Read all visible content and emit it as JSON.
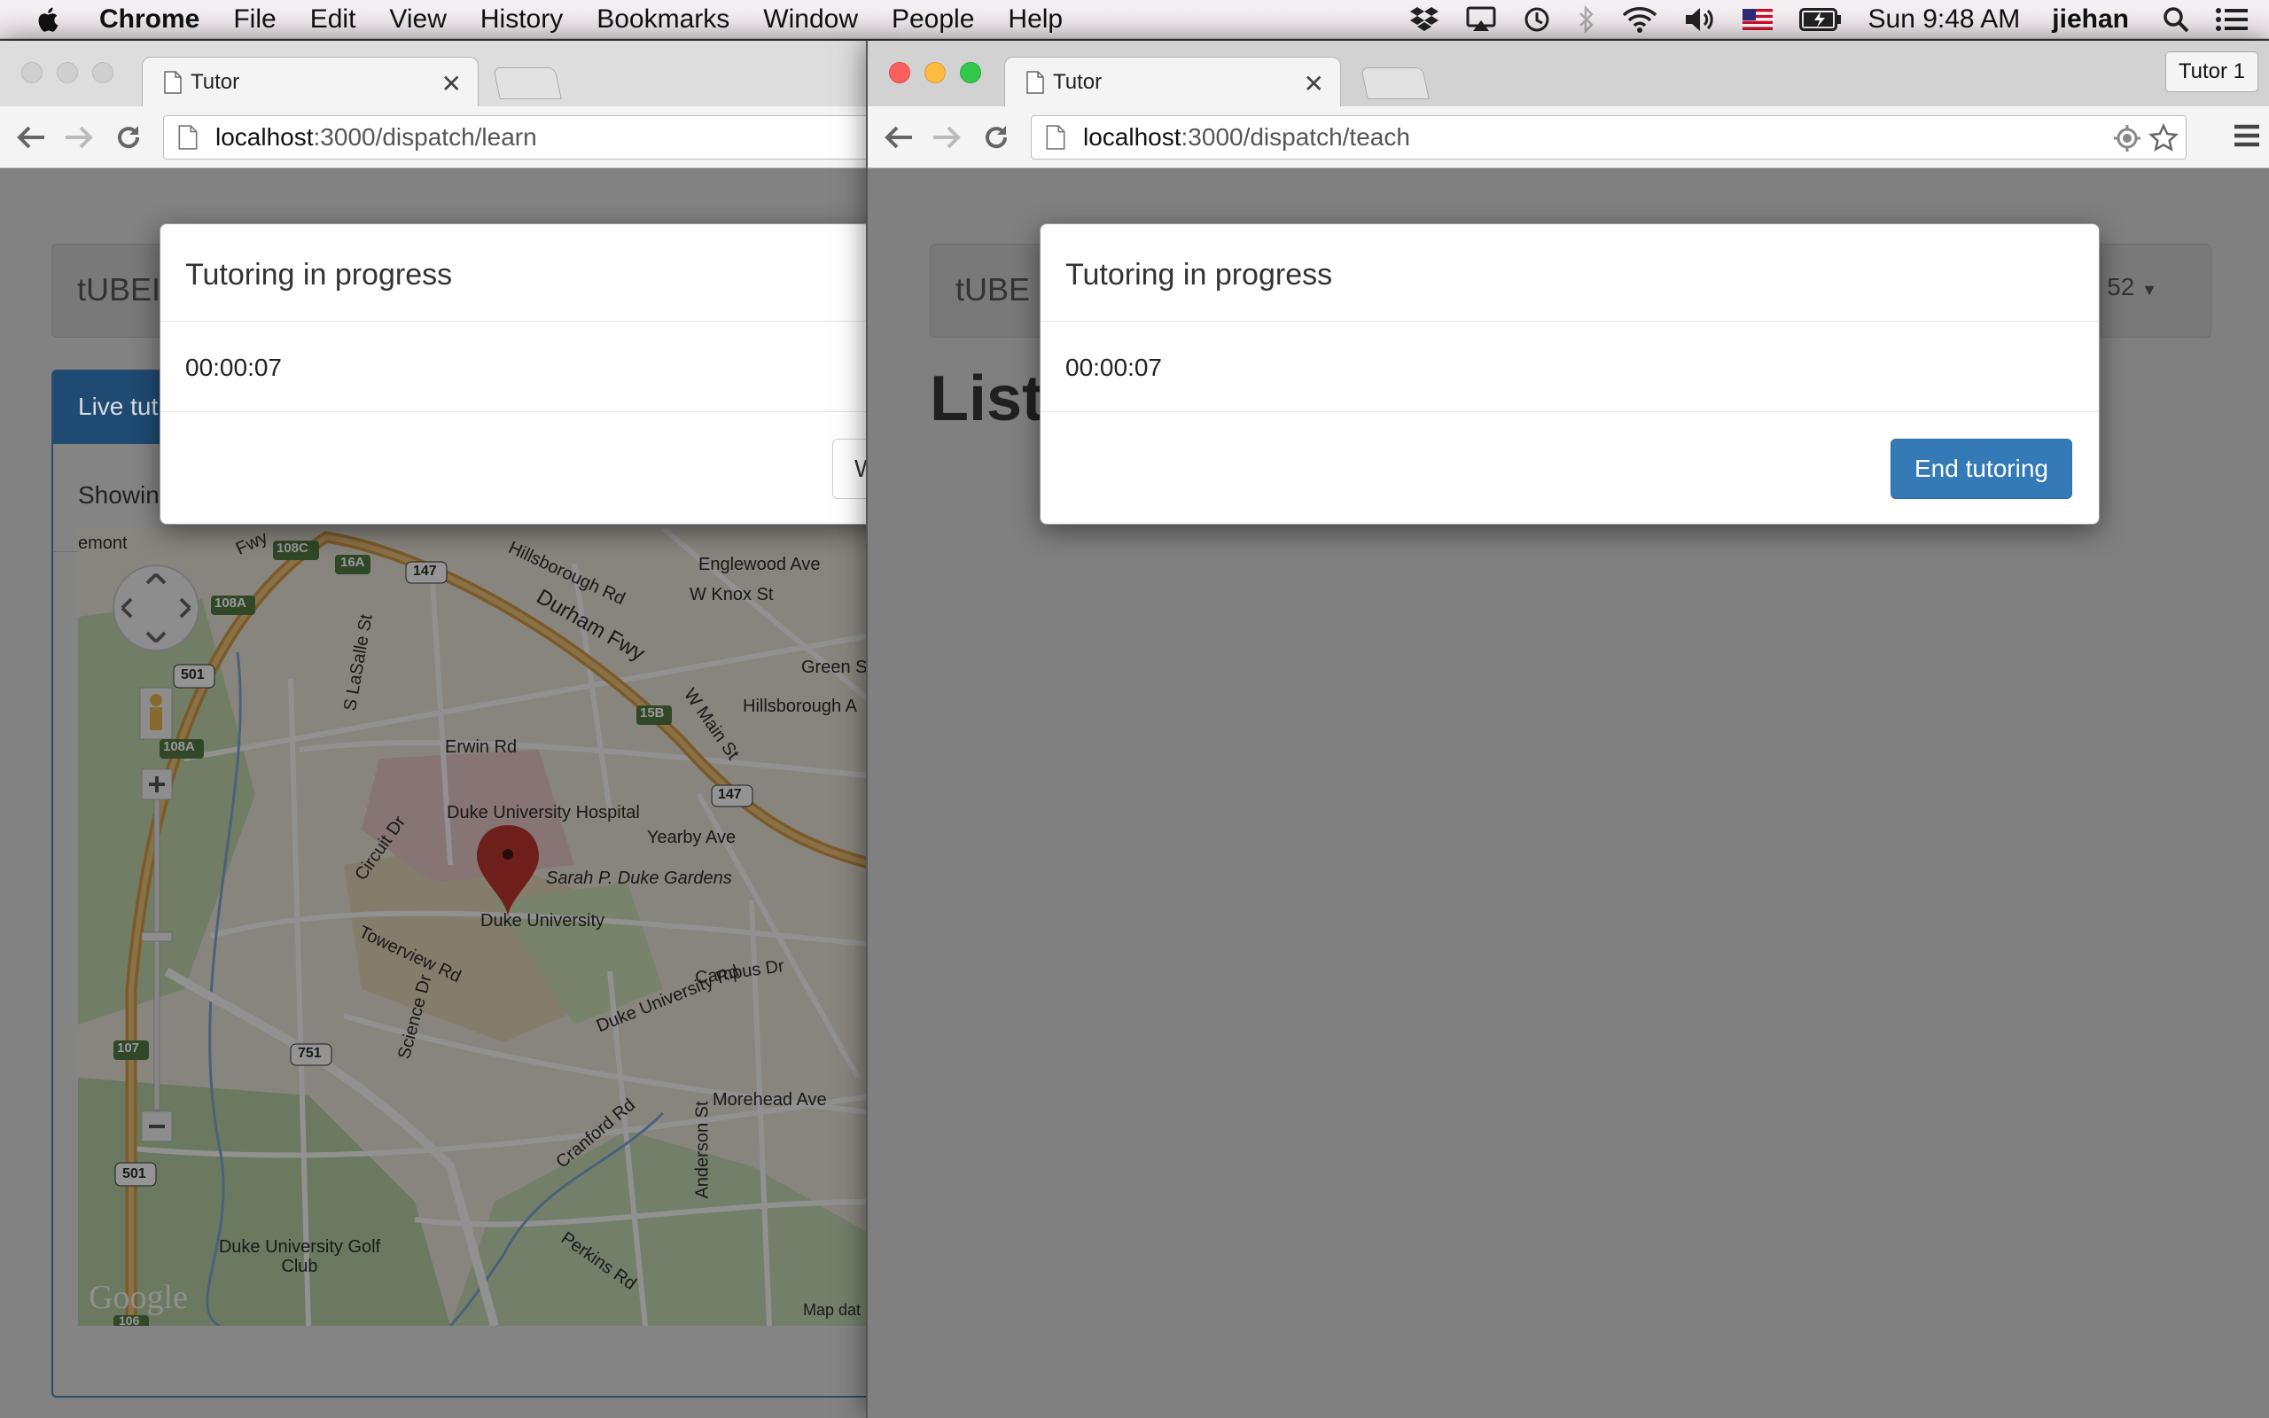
{
  "menubar": {
    "app_name": "Chrome",
    "items": [
      "File",
      "Edit",
      "View",
      "History",
      "Bookmarks",
      "Window",
      "People",
      "Help"
    ],
    "clock": "Sun 9:48 AM",
    "user": "jiehan",
    "status_icons": [
      "dropbox-icon",
      "airplay-icon",
      "time-machine-icon",
      "bluetooth-icon",
      "wifi-icon",
      "volume-icon",
      "us-flag-icon",
      "battery-icon",
      "spotlight-icon",
      "notification-center-icon"
    ]
  },
  "left_window": {
    "tab_title": "Tutor",
    "url_host": "localhost",
    "url_path": ":3000/dispatch/learn",
    "brand": "tUBEI",
    "panel_title": "Live tut",
    "panel_subtitle": "Showin",
    "modal": {
      "title": "Tutoring in progress",
      "timer": "00:00:07",
      "button_label": "W"
    },
    "map": {
      "labels": {
        "hospital": "Duke University Hospital",
        "gardens": "Sarah P. Duke Gardens",
        "university": "Duke University",
        "golf": "Duke University Golf Club",
        "durham_fwy": "Durham Fwy",
        "erwin": "Erwin Rd",
        "hillsborough": "Hillsborough Rd",
        "englewood": "Englewood Ave",
        "knox": "W Knox St",
        "green": "Green St",
        "hillsborough2": "Hillsborough A",
        "wmain": "W Main St",
        "yearby": "Yearby Ave",
        "circuit": "Circuit Dr",
        "towerview": "Towerview Rd",
        "science": "Science Dr",
        "campus": "Campus Dr",
        "dukeuniv_rd": "Duke University Rd",
        "cranford": "Cranford Rd",
        "anderson": "Anderson St",
        "perkins": "Perkins Rd",
        "morehead": "Morehead Ave",
        "lasalle": "S LaSalle St",
        "emont": "emont",
        "fwy": "Fwy",
        "google": "Google",
        "mapdata": "Map dat"
      },
      "shields": {
        "s108c": "108C",
        "s16a": "16A",
        "s147a": "147",
        "s108a": "108A",
        "s501a": "501",
        "s108a2": "108A",
        "s15b": "15B",
        "s147b": "147",
        "s751": "751",
        "s107": "107",
        "s501b": "501",
        "s106": "106"
      }
    }
  },
  "right_window": {
    "tab_title": "Tutor",
    "profile_button": "Tutor 1",
    "url_host": "localhost",
    "url_path": ":3000/dispatch/teach",
    "brand": "tUBE",
    "dropdown_label": "52",
    "page_heading": "List",
    "modal": {
      "title": "Tutoring in progress",
      "timer": "00:00:07",
      "end_button_label": "End tutoring"
    }
  }
}
